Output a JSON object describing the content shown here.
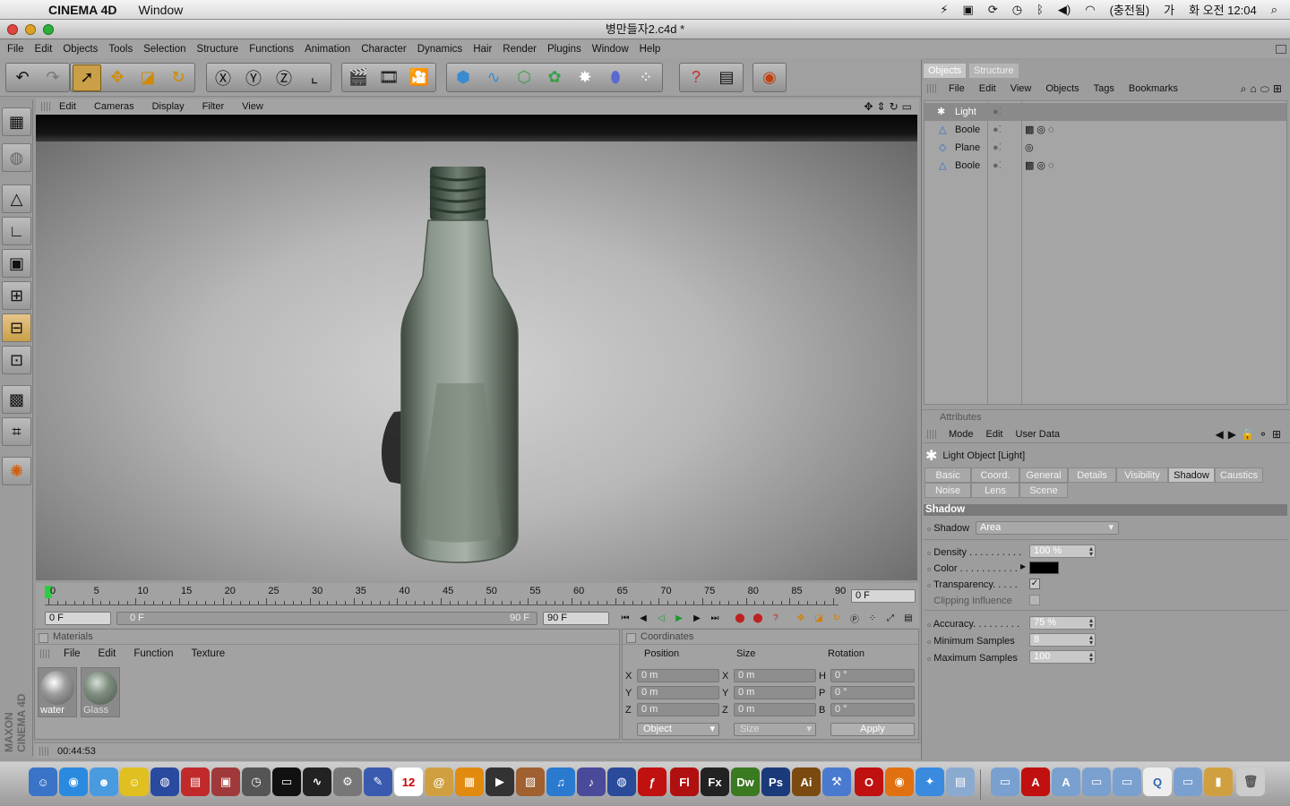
{
  "mac_menubar": {
    "app_name": "CINEMA 4D",
    "items": [
      "Window"
    ],
    "status": [
      "(충전됨)",
      "화 오전 12:04"
    ]
  },
  "window": {
    "title": "병만들자2.c4d *"
  },
  "app_menu": [
    "File",
    "Edit",
    "Objects",
    "Tools",
    "Selection",
    "Structure",
    "Functions",
    "Animation",
    "Character",
    "Dynamics",
    "Hair",
    "Render",
    "Plugins",
    "Window",
    "Help"
  ],
  "viewport_menu": [
    "Edit",
    "Cameras",
    "Display",
    "Filter",
    "View"
  ],
  "timeline": {
    "ticks": [
      "0",
      "5",
      "10",
      "15",
      "20",
      "25",
      "30",
      "35",
      "40",
      "45",
      "50",
      "55",
      "60",
      "65",
      "70",
      "75",
      "80",
      "85",
      "90"
    ],
    "current_frame": "0 F",
    "start_field": "0 F",
    "range_start": "0 F",
    "range_end": "90 F",
    "end_field": "90 F"
  },
  "materials": {
    "title": "Materials",
    "menu": [
      "File",
      "Edit",
      "Function",
      "Texture"
    ],
    "items": [
      {
        "name": "water"
      },
      {
        "name": "Glass"
      }
    ]
  },
  "coordinates": {
    "title": "Coordinates",
    "headers": [
      "Position",
      "Size",
      "Rotation"
    ],
    "rows": [
      {
        "axis": "X",
        "pos": "0 m",
        "size_axis": "X",
        "size": "0 m",
        "rot_axis": "H",
        "rot": "0 °"
      },
      {
        "axis": "Y",
        "pos": "0 m",
        "size_axis": "Y",
        "size": "0 m",
        "rot_axis": "P",
        "rot": "0 °"
      },
      {
        "axis": "Z",
        "pos": "0 m",
        "size_axis": "Z",
        "size": "0 m",
        "rot_axis": "B",
        "rot": "0 °"
      }
    ],
    "mode_select": "Object",
    "size_select": "Size",
    "apply": "Apply"
  },
  "status_time": "00:44:53",
  "objects_panel": {
    "tabs": [
      "Objects",
      "Structure"
    ],
    "menu": [
      "File",
      "Edit",
      "View",
      "Objects",
      "Tags",
      "Bookmarks"
    ],
    "rows": [
      {
        "name": "Light"
      },
      {
        "name": "Boole"
      },
      {
        "name": "Plane"
      },
      {
        "name": "Boole"
      }
    ]
  },
  "attributes": {
    "title": "Attributes",
    "menu": [
      "Mode",
      "Edit",
      "User Data"
    ],
    "object_title": "Light Object [Light]",
    "tabs_row1": [
      "Basic",
      "Coord.",
      "General",
      "Details",
      "Visibility",
      "Shadow",
      "Caustics"
    ],
    "tabs_row2": [
      "Noise",
      "Lens",
      "Scene"
    ],
    "active_tab": "Shadow",
    "section": "Shadow",
    "shadow_label": "Shadow",
    "shadow_value": "Area",
    "props": [
      {
        "label": "Density . . . . . . . . . .",
        "value": "100 %"
      },
      {
        "label": "Color . . . . . . . . . . .",
        "value": ""
      },
      {
        "label": "Transparency. . . . .",
        "value": "✓"
      },
      {
        "label": "Clipping Influence",
        "value": ""
      }
    ],
    "props2": [
      {
        "label": "Accuracy. . . . . . . . .",
        "value": "75 %"
      },
      {
        "label": "Minimum Samples",
        "value": "8"
      },
      {
        "label": "Maximum Samples",
        "value": "100"
      }
    ]
  },
  "side_brand": "MAXON CINEMA 4D",
  "dock_labels": [
    "Fl",
    "Fx",
    "Dw",
    "Ps",
    "Ai",
    "12"
  ]
}
